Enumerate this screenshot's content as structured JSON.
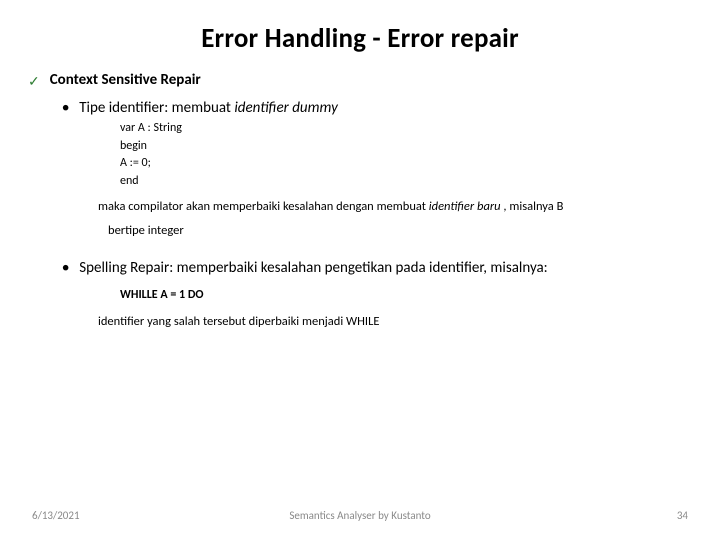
{
  "title": "Error Handling - Error repair",
  "section": {
    "heading": "Context Sensitive Repair",
    "bullets": [
      {
        "label_prefix": "Tipe identifier: membuat ",
        "label_italic": "identifier dummy",
        "code": [
          "var A : String",
          "begin",
          " A := 0;",
          "end"
        ],
        "expl_pre": "maka compilator akan memperbaiki kesalahan dengan membuat ",
        "expl_italic": "identifier baru ",
        "expl_post": ", misalnya B",
        "expl_line2": "bertipe integer"
      },
      {
        "label": "Spelling Repair: memperbaiki kesalahan pengetikan pada identifier, misalnya:",
        "code_line": "WHILLE  A = 1  DO",
        "expl": "identifier yang salah tersebut diperbaiki menjadi  WHILE"
      }
    ]
  },
  "footer": {
    "date": "6/13/2021",
    "center": "Semantics Analyser by Kustanto",
    "page": "34"
  }
}
